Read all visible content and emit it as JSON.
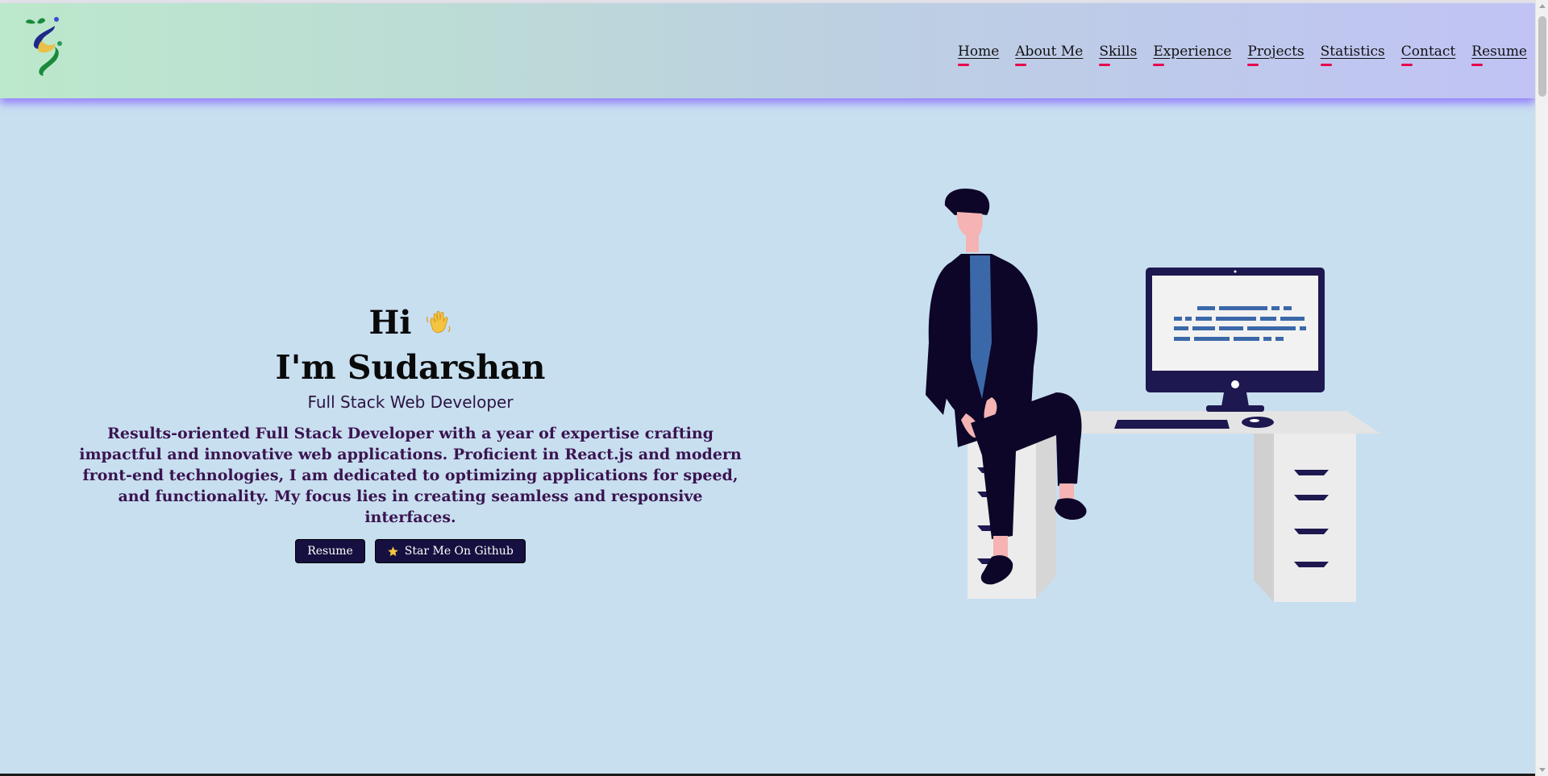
{
  "header": {
    "logo_icon": "leaf-swirl-logo",
    "nav": [
      {
        "label": "Home"
      },
      {
        "label": "About Me"
      },
      {
        "label": "Skills"
      },
      {
        "label": "Experience"
      },
      {
        "label": "Projects"
      },
      {
        "label": "Statistics"
      },
      {
        "label": "Contact"
      },
      {
        "label": "Resume"
      }
    ],
    "accent_color": "#e8004e"
  },
  "hero": {
    "greeting": "Hi",
    "greeting_icon": "waving-hand-icon",
    "name": "I'm Sudarshan",
    "role": "Full Stack Web Developer",
    "description": "Results-oriented Full Stack Developer with a year of expertise crafting impactful and innovative web applications. Proficient in React.js and modern front-end technologies, I am dedicated to optimizing applications for speed, and functionality. My focus lies in creating seamless and responsive interfaces.",
    "buttons": {
      "resume_label": "Resume",
      "github_label": "Star Me On Github",
      "github_icon": "star-icon"
    },
    "button_color": "#15103f"
  },
  "illustration": {
    "icon": "developer-at-desk-illustration"
  },
  "colors": {
    "background": "#c8dff0",
    "header_gradient_start": "#bce8cb",
    "header_gradient_end": "#c0c3f4"
  }
}
